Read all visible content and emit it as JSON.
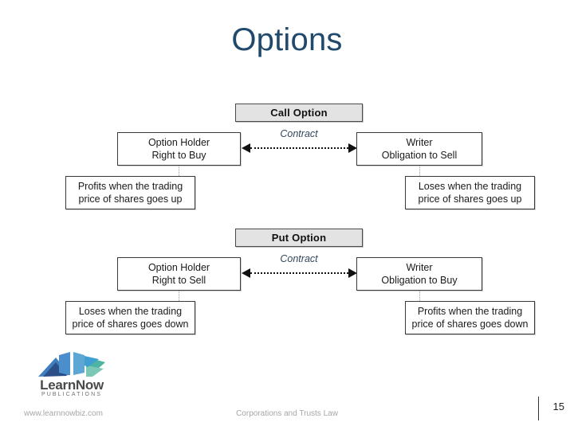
{
  "slide": {
    "title": "Options",
    "page_number": "15",
    "background_color": "#ffffff",
    "title_color": "#21496B"
  },
  "diagrams": [
    {
      "id": "call-option",
      "header": "Call Option",
      "contract_label": "Contract",
      "left_party": {
        "line1": "Option Holder",
        "line2": "Right to Buy"
      },
      "right_party": {
        "line1": "Writer",
        "line2": "Obligation to Sell"
      },
      "left_outcome": {
        "line1": "Profits when the trading",
        "line2": "price of shares goes up"
      },
      "right_outcome": {
        "line1": "Loses when the trading",
        "line2": "price of shares goes up"
      }
    },
    {
      "id": "put-option",
      "header": "Put Option",
      "contract_label": "Contract",
      "left_party": {
        "line1": "Option Holder",
        "line2": "Right to Sell"
      },
      "right_party": {
        "line1": "Writer",
        "line2": "Obligation to Buy"
      },
      "left_outcome": {
        "line1": "Loses when the trading",
        "line2": "price of shares goes down"
      },
      "right_outcome": {
        "line1": "Profits when the trading",
        "line2": "price of shares goes down"
      }
    }
  ],
  "footer": {
    "website": "www.learnnowbiz.com",
    "course": "Corporations and Trusts Law"
  },
  "logo": {
    "name": "LearnNow",
    "tagline": "PUBLICATIONS",
    "colors": {
      "blue": "#3f7fbf",
      "navy": "#2b4f86",
      "teal": "#4fb3a4",
      "light_blue": "#6fa8d6"
    }
  }
}
